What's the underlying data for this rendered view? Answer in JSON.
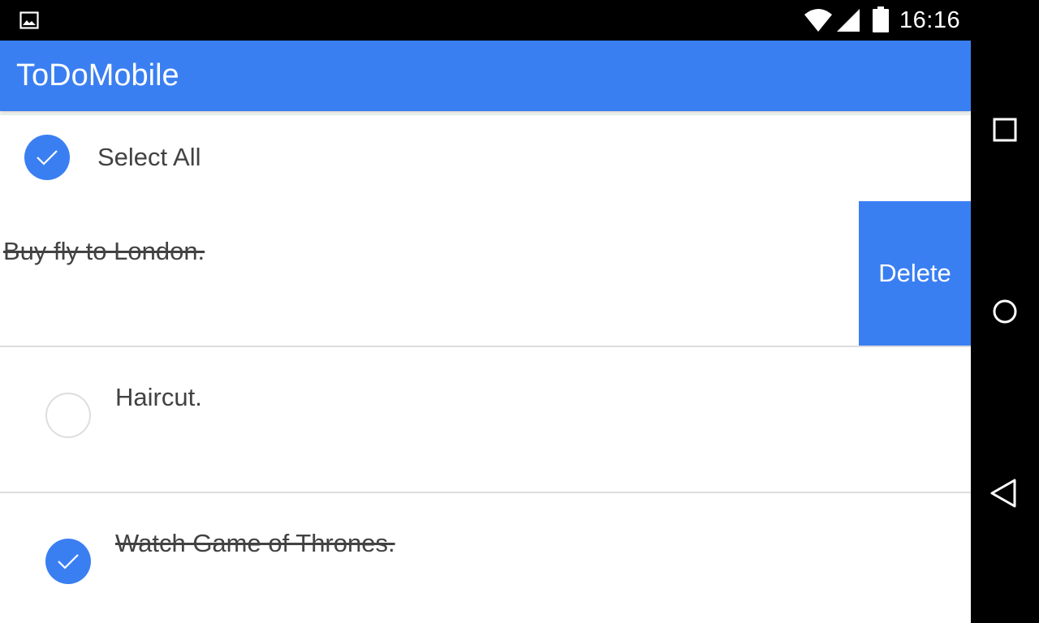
{
  "status_bar": {
    "time": "16:16",
    "icons": [
      "gallery-icon",
      "wifi-icon",
      "signal-icon",
      "battery-icon"
    ]
  },
  "app": {
    "title": "ToDoMobile",
    "accent_color": "#3a7ff2"
  },
  "list": {
    "select_all": {
      "label": "Select All",
      "checked": true
    },
    "items": [
      {
        "text": "Buy fly to London.",
        "done": true,
        "swiped": true
      },
      {
        "text": "Haircut.",
        "done": false
      },
      {
        "text": "Watch Game of Thrones.",
        "done": true
      }
    ],
    "swipe_action_label": "Delete"
  },
  "nav_bar": {
    "buttons": [
      "recents-icon",
      "home-icon",
      "back-icon"
    ]
  }
}
